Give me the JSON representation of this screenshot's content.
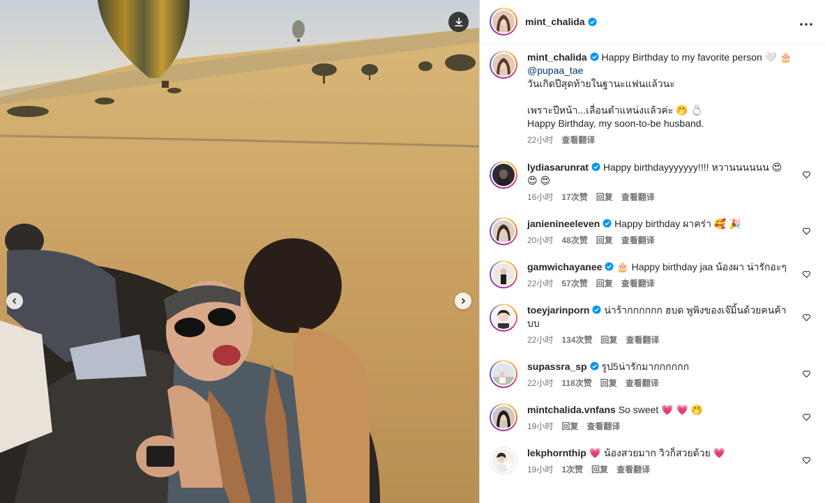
{
  "post": {
    "author": "mint_chalida",
    "caption_lines": [
      "Happy Birthday to my favorite person 🤍 🎂",
      "@pupaa_tae",
      "วันเกิดปีสุดท้ายในฐานะแฟนแล้วนะ",
      "",
      "เพราะปีหน้า...เลื่อนตำแหน่งแล้วค่ะ 🤭 💍",
      "Happy Birthday, my soon-to-be husband."
    ],
    "time": "22小时",
    "translate": "查看翻译"
  },
  "comments": [
    {
      "user": "lydiasarunrat",
      "verified": true,
      "text": "Happy birthdayyyyyyy!!!! หวานนนนนน 😍 😍 😍",
      "time": "16小时",
      "likes": "17次赞",
      "reply": "回复",
      "translate": "查看翻译"
    },
    {
      "user": "janienineeleven",
      "verified": true,
      "text": "Happy birthday ผาคร่า 🥰 🎉",
      "time": "20小时",
      "likes": "48次赞",
      "reply": "回复",
      "translate": "查看翻译"
    },
    {
      "user": "gamwichayanee",
      "verified": true,
      "text": "🎂 Happy birthday jaa น้องผา น่ารักอะๆ",
      "time": "22小时",
      "likes": "57次赞",
      "reply": "回复",
      "translate": "查看翻译"
    },
    {
      "user": "toeyjarinporn",
      "verified": true,
      "text": "น่าร้ากกกกกก ฮบด พูพิงของเจ๊มิ้นด้วยคนค้าบบ",
      "time": "22小时",
      "likes": "134次赞",
      "reply": "回复",
      "translate": "查看翻译"
    },
    {
      "user": "supassra_sp",
      "verified": true,
      "text": "รูป5น่ารักมากกกกกก",
      "time": "22小时",
      "likes": "118次赞",
      "reply": "回复",
      "translate": "查看翻译"
    },
    {
      "user": "mintchalida.vnfans",
      "verified": false,
      "text": "So sweet 💗 💗 🤭",
      "time": "19小时",
      "likes": "",
      "reply": "回复",
      "translate": "查看翻译"
    },
    {
      "user": "lekphornthip",
      "verified": false,
      "text": "💗 น้องสวยมาก วิวก็สวยด้วย 💗",
      "time": "19小时",
      "likes": "1次赞",
      "reply": "回复",
      "translate": "查看翻译"
    }
  ],
  "colors": {
    "verified": "#0095f6",
    "link": "#00376b",
    "meta": "#737373"
  }
}
